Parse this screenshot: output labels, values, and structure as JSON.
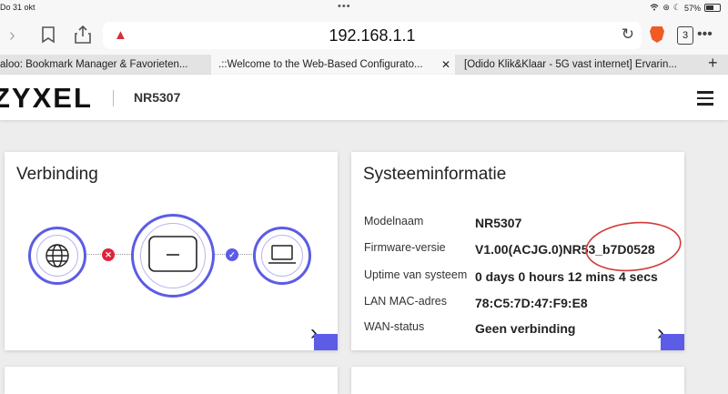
{
  "status_bar": {
    "date": "Do 31 okt",
    "battery": "57%",
    "battery_level": 0.57
  },
  "browser": {
    "url": "192.168.1.1",
    "tab_count": "3",
    "tabs": [
      {
        "label": "aloo: Bookmark Manager & Favorieten..."
      },
      {
        "label": ".::Welcome to the Web-Based Configurato..."
      },
      {
        "label": "[Odido Klik&Klaar - 5G vast internet] Ervarin..."
      }
    ]
  },
  "header": {
    "logo": "ZYXEL",
    "model": "NR5307"
  },
  "connection_card": {
    "title": "Verbinding"
  },
  "sysinfo_card": {
    "title": "Systeeminformatie",
    "rows": [
      {
        "label": "Modelnaam",
        "value": "NR5307"
      },
      {
        "label": "Firmware-versie",
        "value": "V1.00(ACJG.0)NR53_b7D0528"
      },
      {
        "label": "Uptime van systeem",
        "value": "0 days 0 hours 12 mins 4 secs"
      },
      {
        "label": "LAN MAC-adres",
        "value": "78:C5:7D:47:F9:E8"
      },
      {
        "label": "WAN-status",
        "value": "Geen verbinding"
      }
    ]
  },
  "colors": {
    "accent": "#5c5ce6",
    "error": "#e0243a",
    "ok": "#5c5ce6",
    "annotation": "#d23a3a"
  }
}
